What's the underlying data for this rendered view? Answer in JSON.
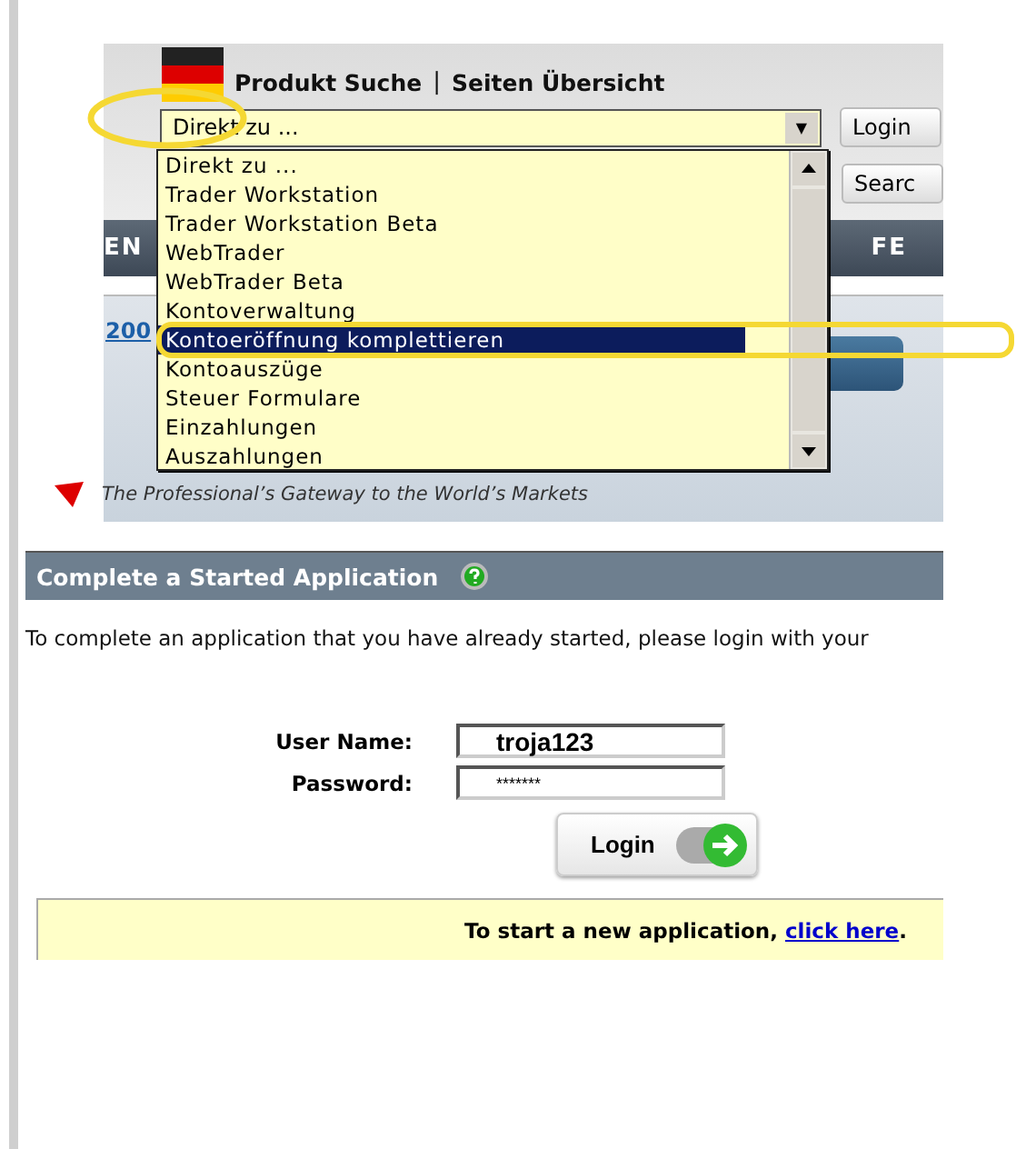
{
  "header": {
    "links": [
      "Produkt Suche",
      "Seiten Übersicht"
    ],
    "separator": "|",
    "select": {
      "value": "Direkt zu ...",
      "arrow": "▼"
    },
    "buttons": [
      "Login",
      "Searc"
    ],
    "dropdown": {
      "items": [
        {
          "label": "Direkt zu ...",
          "selected": false
        },
        {
          "label": "Trader Workstation",
          "selected": false
        },
        {
          "label": "Trader Workstation Beta",
          "selected": false
        },
        {
          "label": "WebTrader",
          "selected": false
        },
        {
          "label": "WebTrader Beta",
          "selected": false
        },
        {
          "label": "Kontoverwaltung",
          "selected": false
        },
        {
          "label": "Kontoeröffnung komplettieren",
          "selected": true
        },
        {
          "label": "Kontoauszüge",
          "selected": false
        },
        {
          "label": "Steuer Formulare",
          "selected": false
        },
        {
          "label": "Einzahlungen",
          "selected": false
        },
        {
          "label": "Auszahlungen",
          "selected": false
        }
      ]
    },
    "nav": {
      "left": "EN",
      "right": "FE"
    },
    "year_link": "200",
    "tagline": "The Professional’s Gateway to the World’s Markets"
  },
  "section": {
    "title": "Complete a Started Application",
    "intro": "To complete an application that you have already started, please login with your"
  },
  "form": {
    "fields": [
      {
        "label": "User Name:",
        "value": "troja123",
        "kind": "text"
      },
      {
        "label": "Password:",
        "value": "*******",
        "kind": "password"
      }
    ],
    "submit": "Login"
  },
  "notice": {
    "text": "To start a new application,",
    "link": "click here",
    "after": "."
  }
}
